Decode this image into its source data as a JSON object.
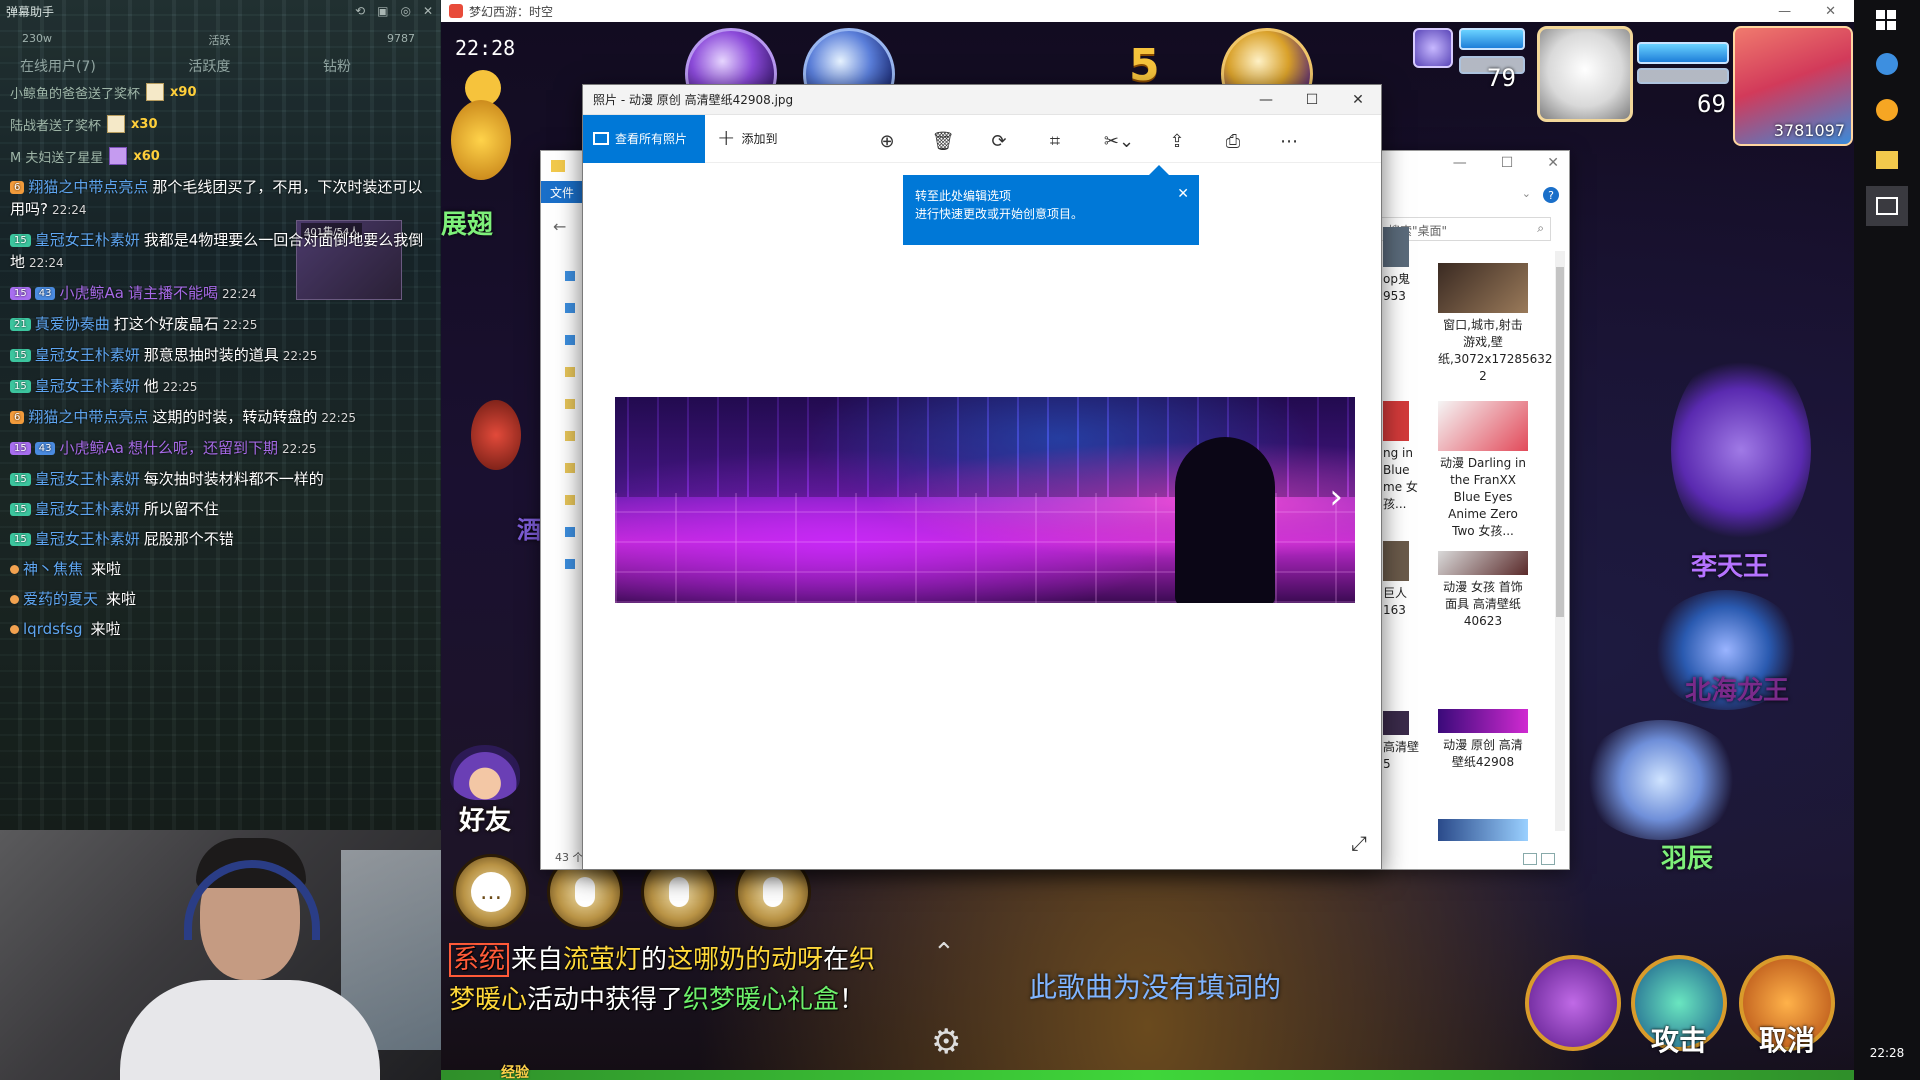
{
  "chat": {
    "title": "弹幕助手",
    "controls": [
      "⟲",
      "▣",
      "◎",
      "✕"
    ],
    "stats": [
      "230w",
      "活跃",
      "9787"
    ],
    "tabs": [
      "在线用户(7)",
      "活跃度",
      "钻粉"
    ],
    "gifts": [
      {
        "text": "小鲸鱼的爸爸送了奖杯",
        "count": "x90"
      },
      {
        "text": "陆战者送了奖杯",
        "count": "x30"
      },
      {
        "text": "M 夫妇送了星星",
        "count": "x60"
      }
    ],
    "avatar_card_label": "401集/54人",
    "messages": [
      {
        "level": "6",
        "badge_color": "orange",
        "user": "翔猫之中带点亮点",
        "text": "那个毛线团买了，不用，下次时装还可以用吗?",
        "time": "22:24"
      },
      {
        "level": "15",
        "badge_color": "green",
        "user": "皇冠女王朴素妍",
        "text": "我都是4物理要么一回合对面倒地要么我倒地",
        "time": "22:24"
      },
      {
        "level": "15",
        "badge_color": "purple",
        "extra_badge": "43",
        "user": "小虎鲸Aa",
        "text": "请主播不能喝",
        "time": "22:24"
      },
      {
        "level": "21",
        "badge_color": "green",
        "user": "真爱协奏曲",
        "text": "打这个好废晶石",
        "time": "22:25"
      },
      {
        "level": "15",
        "badge_color": "green",
        "user": "皇冠女王朴素妍",
        "text": "那意思抽时装的道具",
        "time": "22:25"
      },
      {
        "level": "15",
        "badge_color": "green",
        "user": "皇冠女王朴素妍",
        "text": "他",
        "time": "22:25"
      },
      {
        "level": "6",
        "badge_color": "orange",
        "user": "翔猫之中带点亮点",
        "text": "这期的时装，转动转盘的",
        "time": "22:25"
      },
      {
        "level": "15",
        "badge_color": "purple",
        "extra_badge": "43",
        "user": "小虎鲸Aa",
        "text": "想什么呢，还留到下期",
        "time": "22:25"
      },
      {
        "level": "15",
        "badge_color": "green",
        "user": "皇冠女王朴素妍",
        "text": "每次抽时装材料都不一样的",
        "time": ""
      },
      {
        "level": "15",
        "badge_color": "green",
        "user": "皇冠女王朴素妍",
        "text": "所以留不住",
        "time": ""
      },
      {
        "level": "15",
        "badge_color": "green",
        "user": "皇冠女王朴素妍",
        "text": "屁股那个不错",
        "time": ""
      }
    ],
    "entries": [
      {
        "user": "神丶焦焦",
        "text": "来啦"
      },
      {
        "user": "爱药的夏天",
        "text": "来啦"
      },
      {
        "user": "lqrdsfsg",
        "text": "来啦"
      }
    ]
  },
  "game": {
    "window_title": "梦幻西游：时空",
    "window_controls": [
      "—",
      "✕"
    ],
    "time": "22:28",
    "round_number": "5",
    "left_label": "展翅",
    "side_text": "酒",
    "pet_hp": "79",
    "hero_hp": "69",
    "hero_id": "3781097",
    "friend_label": "好友",
    "system_tag": "系统",
    "system_msg_parts": [
      {
        "t": "来自",
        "c": "white"
      },
      {
        "t": "流萤灯",
        "c": "yel"
      },
      {
        "t": "的",
        "c": "white"
      },
      {
        "t": "这哪奶的动呀",
        "c": "yel"
      },
      {
        "t": "在",
        "c": "white"
      },
      {
        "t": "织梦暖心",
        "c": "yel"
      },
      {
        "t": "活动中获得了",
        "c": "white"
      },
      {
        "t": "织梦暖心礼盒",
        "c": "grn"
      },
      {
        "t": "！",
        "c": "white"
      }
    ],
    "lyric": "此歌曲为没有填词的",
    "npc_names": [
      "李天王",
      "北海龙王",
      "羽辰"
    ],
    "actions": [
      "攻击",
      "取消"
    ],
    "exp_label": "经验"
  },
  "explorer": {
    "tab_label": "文件",
    "search_placeholder": "搜索\"桌面\"",
    "status": "43 个项目",
    "files": [
      {
        "name": "窗口,城市,射击游戏,壁纸,3072x17285632 2"
      },
      {
        "name": "动漫 Darling in the FranXX Blue Eyes Anime Zero Two 女孩..."
      },
      {
        "name": "动漫 女孩 首饰 面具 高清壁纸 40623"
      },
      {
        "name": "动漫 原创 高清壁纸42908"
      }
    ],
    "partials": [
      "op鬼 953",
      "ng in Blue me 女孩...",
      "巨人 163",
      "高清壁 5"
    ]
  },
  "photos": {
    "title": "照片 - 动漫 原创 高清壁纸42908.jpg",
    "view_all": "查看所有照片",
    "add_to": "添加到",
    "tooltip_title": "转至此处编辑选项",
    "tooltip_body": "进行快速更改或开始创意项目。",
    "tools": [
      "zoom-in",
      "delete",
      "rotate",
      "crop",
      "edit-create",
      "share",
      "print",
      "more"
    ]
  },
  "taskbar": {
    "clock": "22:28"
  }
}
